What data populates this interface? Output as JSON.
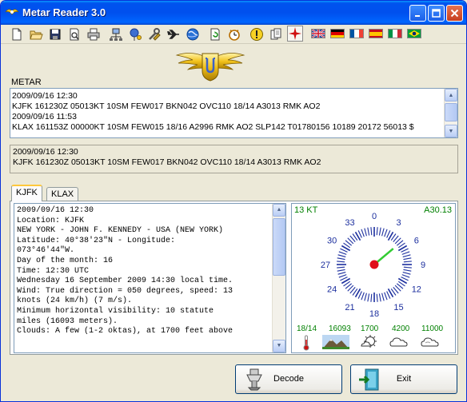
{
  "window": {
    "title": "Metar Reader 3.0",
    "controls": [
      "minimize",
      "maximize",
      "close"
    ]
  },
  "toolbar": {
    "tools": [
      "new-file-icon",
      "open-folder-icon",
      "save-icon",
      "print-preview-icon",
      "print-icon",
      "network-icon",
      "map-pin-icon",
      "airplane-icon",
      "globe-icon",
      "refresh-icon",
      "clock-icon",
      "warning-icon",
      "copy-icon",
      "compass-star-icon"
    ],
    "flags": [
      {
        "name": "flag-uk",
        "colors": [
          "#1e3f94",
          "#ffffff",
          "#cf142b"
        ]
      },
      {
        "name": "flag-germany",
        "colors": [
          "#000000",
          "#dd0000",
          "#ffce00"
        ]
      },
      {
        "name": "flag-france",
        "colors": [
          "#0055a4",
          "#ffffff",
          "#ef4135"
        ]
      },
      {
        "name": "flag-spain",
        "colors": [
          "#c60b1e",
          "#ffc400",
          "#c60b1e"
        ]
      },
      {
        "name": "flag-italy",
        "colors": [
          "#009246",
          "#ffffff",
          "#ce2b37"
        ]
      },
      {
        "name": "flag-brazil",
        "colors": [
          "#009c3b",
          "#ffdf00",
          "#002776"
        ]
      }
    ]
  },
  "metar": {
    "label": "METAR",
    "lines": [
      "2009/09/16 12:30",
      "KJFK 161230Z 05013KT 10SM FEW017 BKN042 OVC110 18/14 A3013 RMK AO2",
      "2009/09/16 11:53",
      "KLAX 161153Z 00000KT 10SM FEW015 18/16 A2996 RMK AO2 SLP142 T01780156 10189 20172 56013 $"
    ]
  },
  "selected": {
    "lines": [
      "2009/09/16 12:30",
      "KJFK 161230Z 05013KT 10SM FEW017 BKN042 OVC110 18/14 A3013 RMK AO2"
    ]
  },
  "tabs": [
    {
      "label": "KJFK",
      "active": true
    },
    {
      "label": "KLAX",
      "active": false
    }
  ],
  "decoded": {
    "lines": [
      "2009/09/16 12:30",
      "Location: KJFK",
      "NEW YORK - JOHN F. KENNEDY - USA (NEW YORK)",
      "Latitude: 40°38'23\"N - Longitude:",
      "073°46'44\"W.",
      "Day of the month: 16",
      "Time: 12:30 UTC",
      "Wednesday 16 September 2009 14:30 local time.",
      "Wind: True direction = 050 degrees, speed: 13",
      "knots (24 km/h) (7 m/s).",
      "Minimum horizontal visibility: 10 statute",
      "miles (16093 meters).",
      "Clouds: A few (1-2 oktas), at 1700 feet above"
    ]
  },
  "weather": {
    "wind_speed": "13 KT",
    "altimeter": "A30.13",
    "wind_direction_deg": 50,
    "compass_labels": [
      "0",
      "3",
      "6",
      "9",
      "12",
      "15",
      "18",
      "21",
      "24",
      "27",
      "30",
      "33"
    ],
    "stats": [
      "18/14",
      "16093",
      "1700",
      "4200",
      "11000"
    ],
    "icons": [
      "thermometer-icon",
      "mountain-visibility-icon",
      "few-clouds-icon",
      "broken-clouds-icon",
      "overcast-icon"
    ],
    "accent_color": "#008000",
    "dial_color": "#1c2f9e",
    "needle_color": "#33cc33"
  },
  "buttons": {
    "decode_label": "Decode",
    "exit_label": "Exit"
  }
}
